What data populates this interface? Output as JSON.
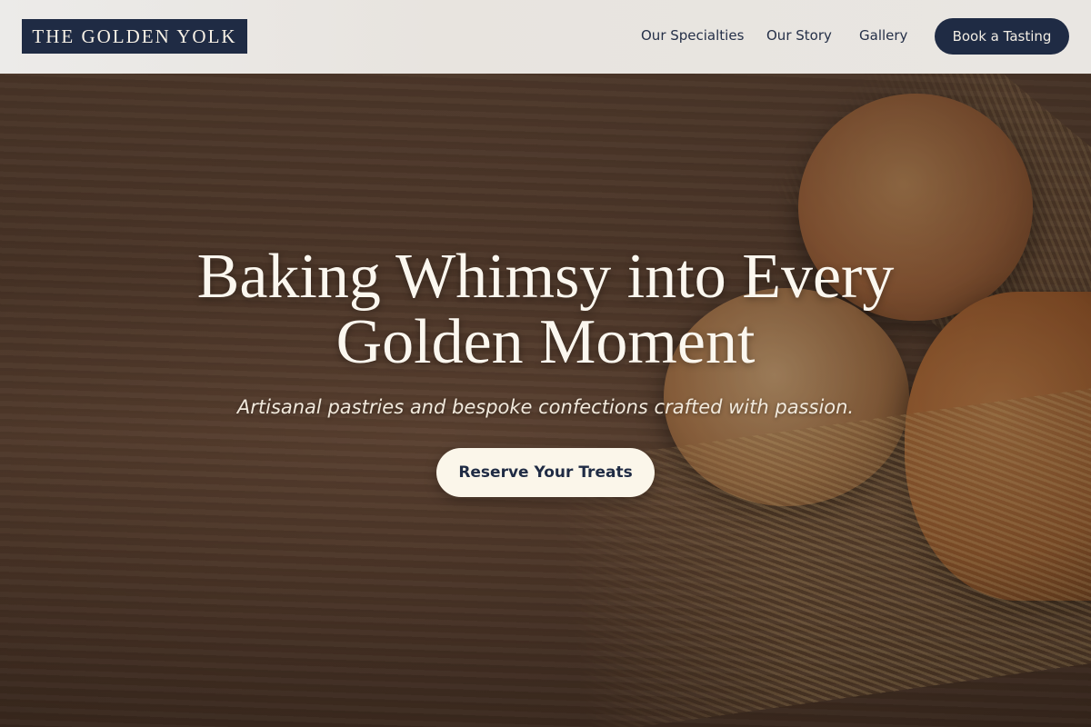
{
  "header": {
    "logo_text": "THE GOLDEN YOLK",
    "nav": [
      {
        "label": "Our Specialties"
      },
      {
        "label": "Our Story"
      },
      {
        "label": "Gallery"
      }
    ],
    "cta_label": "Book a Tasting"
  },
  "hero": {
    "title": "Baking Whimsy into Every Golden Moment",
    "subtitle": "Artisanal pastries and bespoke confections crafted with passion.",
    "button_label": "Reserve Your Treats",
    "image": "wooden table with seeded bread rolls and wheat stalks"
  },
  "colors": {
    "navy": "#1f2b44",
    "cream": "#fbf6ea",
    "header_bg": "#ecebe9"
  }
}
